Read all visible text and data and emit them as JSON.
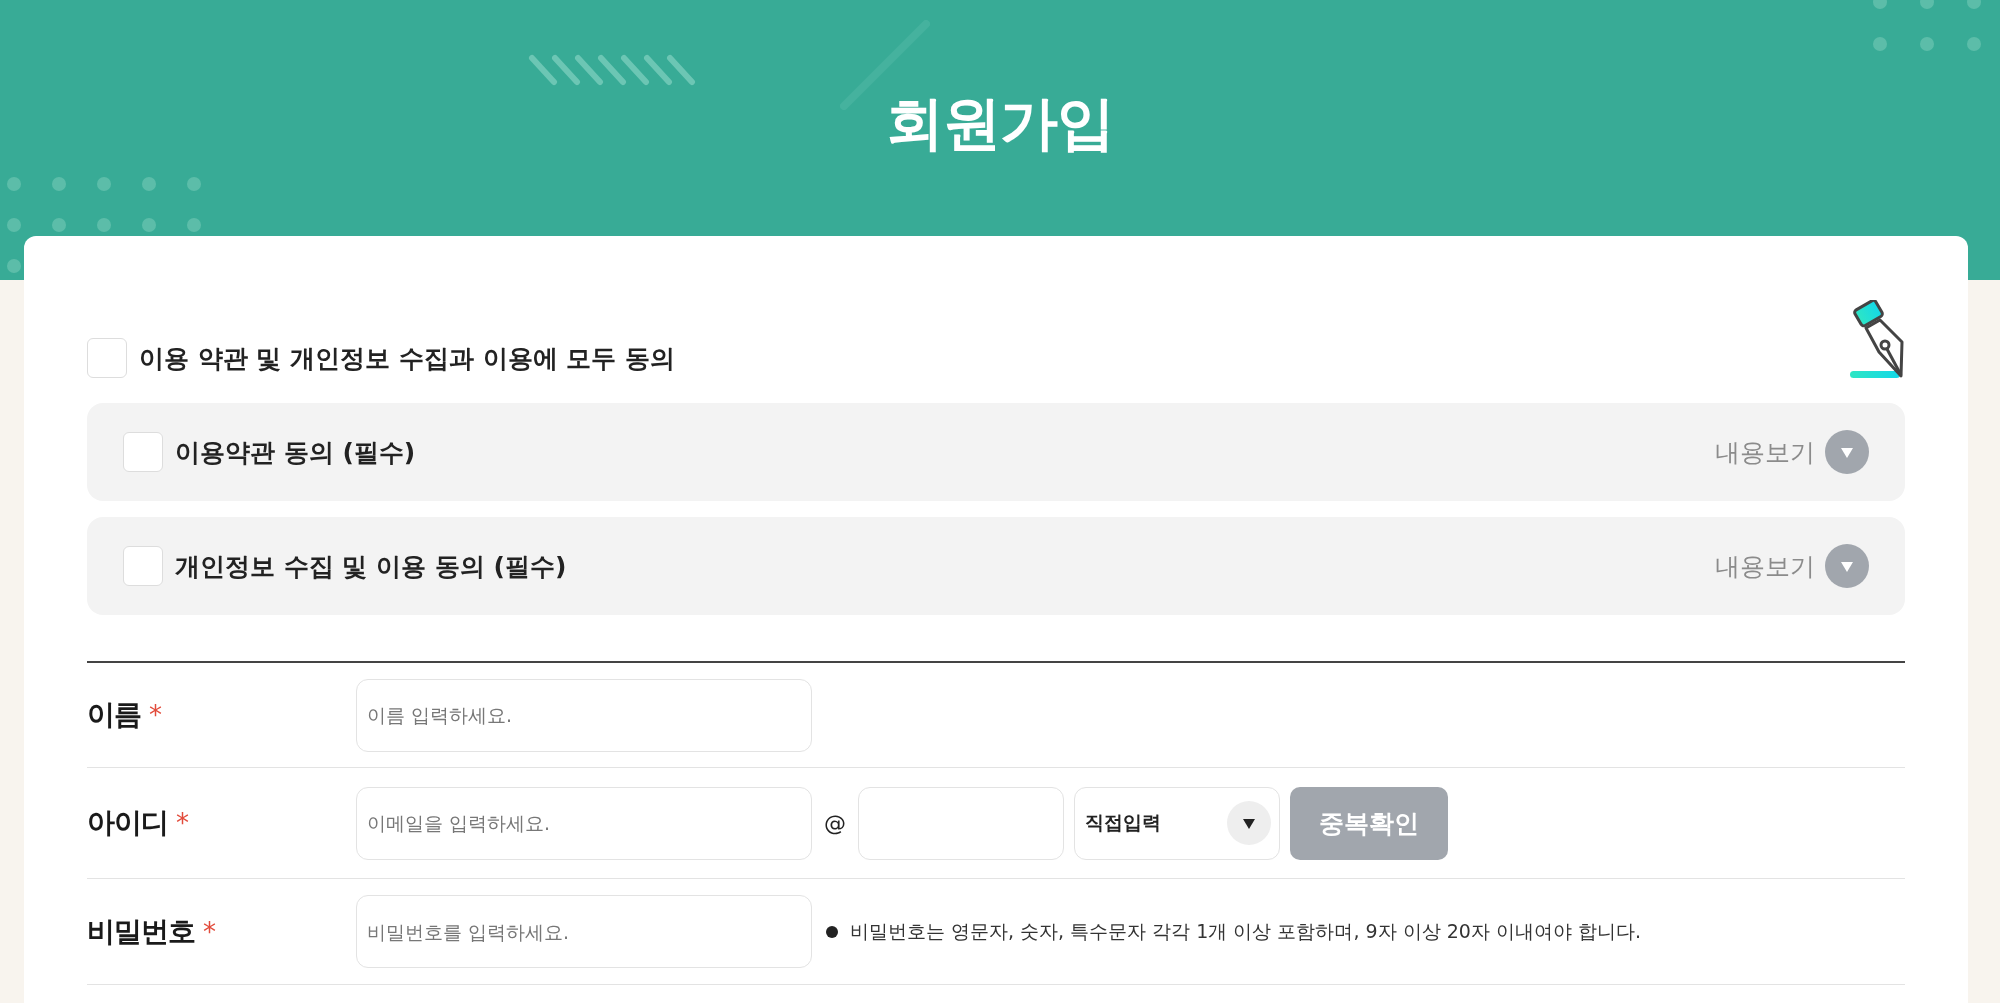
{
  "header": {
    "title": "회원가입"
  },
  "agreements": {
    "all": {
      "label": "이용 약관 및 개인정보 수집과 이용에 모두 동의",
      "checked": false
    },
    "items": [
      {
        "label": "이용약관 동의 (필수)",
        "checked": false,
        "toggle": "내용보기",
        "expanded": false
      },
      {
        "label": "개인정보 수집 및 이용 동의 (필수)",
        "checked": false,
        "toggle": "내용보기",
        "expanded": false
      }
    ]
  },
  "form": {
    "rows": [
      {
        "kind": "text",
        "label": "이름",
        "mark": "*",
        "placeholder": "이름 입력하세요."
      },
      {
        "kind": "email",
        "label": "아이디",
        "mark": "*",
        "placeholder": "이메일을 입력하세요.",
        "separator": "@",
        "domain_select": "직접입력",
        "button": "중복확인"
      },
      {
        "kind": "password",
        "label": "비밀번호",
        "mark": "*",
        "placeholder": "비밀번호를 입력하세요.",
        "hint": "비밀번호는 영문자, 숫자, 특수문자 각각 1개 이상 포함하며, 9자 이상 20자 이내여야 합니다."
      }
    ]
  }
}
